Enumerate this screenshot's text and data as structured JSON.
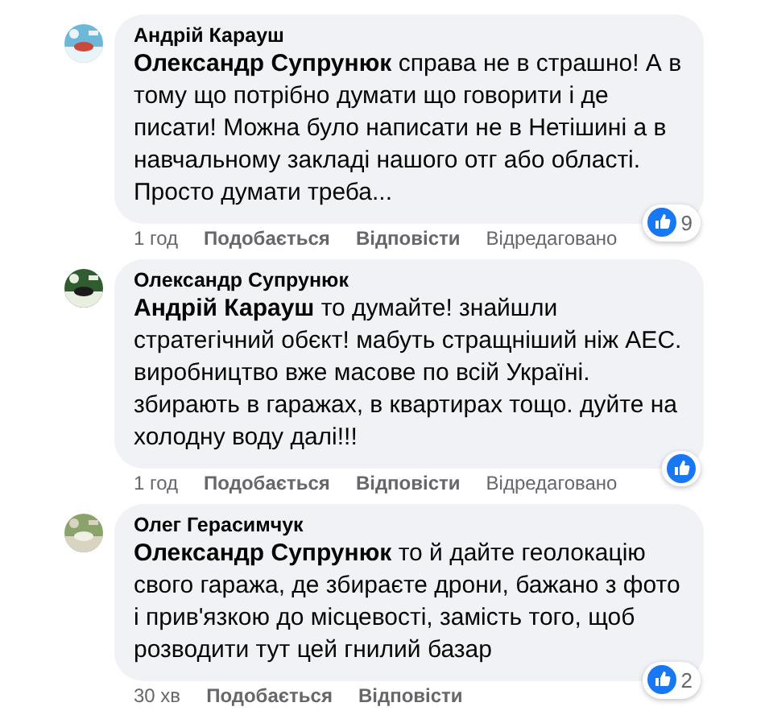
{
  "comments": [
    {
      "author": "Андрій Карауш",
      "avatar": {
        "kind": "picture"
      },
      "text": "**Олександр Супрунюк** справа не в страшно! А в тому що потрібно думати що говорити і де писати! Можна було написати не в Нетішині а в навчальному закладі нашого отг або області. Просто думати треба...",
      "reaction_count": "9",
      "time": "1 год",
      "actions": [
        "Подобається",
        "Відповісти"
      ],
      "edited": "Відредаговано"
    },
    {
      "author": "Олександр Супрунюк",
      "avatar": {
        "kind": "picture"
      },
      "text": "**Андрій Карауш** то думайте! знайшли стратегічний обєкт! мабуть стращніший ніж АЕС. виробництво вже масове по всій Україні. збирають в гаражах, в квартирах тощо. дуйте на холодну воду далі!!!",
      "time": "1 год",
      "actions": [
        "Подобається",
        "Відповісти"
      ],
      "edited": "Відредаговано"
    },
    {
      "author": "Олег Герасимчук",
      "avatar": {
        "kind": "picture"
      },
      "text": "**Олександр Супрунюк** то й дайте геолокацію свого гаража, де збираєте дрони, бажано з фото і прив'язкою до місцевості, замість того, щоб розводити тут цей гнилий базар",
      "reaction_count": "2",
      "time": "30 хв",
      "actions": [
        "Подобається",
        "Відповісти"
      ]
    }
  ]
}
